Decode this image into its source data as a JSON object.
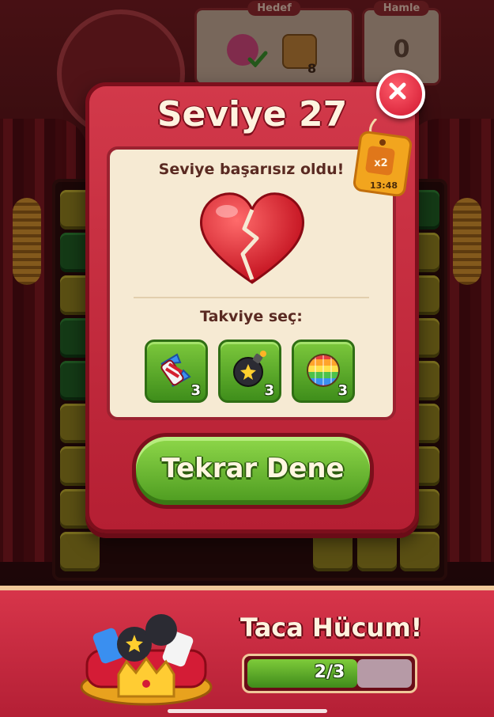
{
  "hud": {
    "goal_label": "Hedef",
    "goal_box_count": "8",
    "moves_label": "Hamle",
    "moves_value": "0"
  },
  "modal": {
    "title": "Seviye 27",
    "failed_text": "Seviye başarısız oldu!",
    "choose_booster_text": "Takviye seç:",
    "boosters": [
      {
        "icon": "rocket-icon",
        "count": "3"
      },
      {
        "icon": "bomb-icon",
        "count": "3"
      },
      {
        "icon": "disco-ball-icon",
        "count": "3"
      }
    ],
    "retry_label": "Tekrar Dene"
  },
  "offer_tag": {
    "multiplier": "x2",
    "timer": "13:48"
  },
  "crown_rush": {
    "title": "Taca Hücum!",
    "progress_text": "2/3",
    "progress_fraction": 0.667
  },
  "colors": {
    "modal_red": "#c72a3d",
    "button_green": "#5cae2b",
    "panel_cream": "#f6ead3"
  }
}
